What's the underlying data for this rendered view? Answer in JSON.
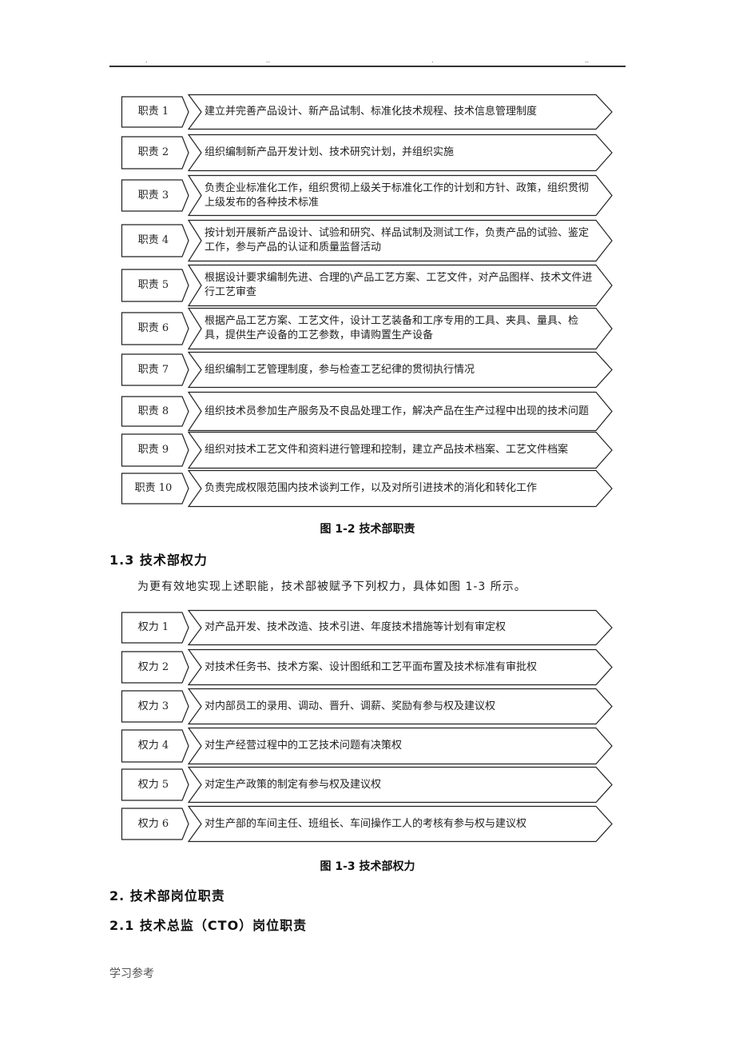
{
  "header": {
    "dots": [
      ".",
      "..",
      ".",
      ".."
    ]
  },
  "figure_1_2": {
    "caption": "图 1-2 技术部职责",
    "items": [
      {
        "label": "职责 1",
        "text": "建立并完善产品设计、新产品试制、标准化技术规程、技术信息管理制度"
      },
      {
        "label": "职责 2",
        "text": "组织编制新产品开发计划、技术研究计划，并组织实施"
      },
      {
        "label": "职责 3",
        "text": "负责企业标准化工作，组织贯彻上级关于标准化工作的计划和方针、政策，组织贯彻上级发布的各种技术标准"
      },
      {
        "label": "职责 4",
        "text": "按计划开展新产品设计、试验和研究、样品试制及测试工作，负责产品的试验、鉴定工作，参与产品的认证和质量监督活动"
      },
      {
        "label": "职责 5",
        "text": "根据设计要求编制先进、合理的\\产品工艺方案、工艺文件，对产品图样、技术文件进行工艺审查"
      },
      {
        "label": "职责 6",
        "text": "根据产品工艺方案、工艺文件，设计工艺装备和工序专用的工具、夹具、量具、检具，提供生产设备的工艺参数，申请购置生产设备"
      },
      {
        "label": "职责 7",
        "text": "组织编制工艺管理制度，参与检查工艺纪律的贯彻执行情况"
      },
      {
        "label": "职责 8",
        "text": "组织技术员参加生产服务及不良品处理工作，解决产品在生产过程中出现的技术问题"
      },
      {
        "label": "职责 9",
        "text": "组织对技术工艺文件和资料进行管理和控制，建立产品技术档案、工艺文件档案"
      },
      {
        "label": "职责 10",
        "text": "负责完成权限范围内技术谈判工作，以及对所引进技术的消化和转化工作"
      }
    ]
  },
  "section_1_3": {
    "heading": "1.3 技术部权力",
    "intro": "为更有效地实现上述职能，技术部被赋予下列权力，具体如图 1-3 所示。"
  },
  "figure_1_3": {
    "caption": "图 1-3 技术部权力",
    "items": [
      {
        "label": "权力 1",
        "text": "对产品开发、技术改造、技术引进、年度技术措施等计划有审定权"
      },
      {
        "label": "权力 2",
        "text": "对技术任务书、技术方案、设计图纸和工艺平面布置及技术标准有审批权"
      },
      {
        "label": "权力 3",
        "text": "对内部员工的录用、调动、晋升、调薪、奖励有参与权及建议权"
      },
      {
        "label": "权力 4",
        "text": "对生产经营过程中的工艺技术问题有决策权"
      },
      {
        "label": "权力 5",
        "text": "对定生产政策的制定有参与权及建议权"
      },
      {
        "label": "权力 6",
        "text": "对生产部的车间主任、班组长、车间操作工人的考核有参与权与建议权"
      }
    ]
  },
  "section_2": {
    "heading": "2.  技术部岗位职责"
  },
  "section_2_1": {
    "heading": "2.1 技术总监（CTO）岗位职责"
  },
  "footer": {
    "text": "学习参考"
  }
}
